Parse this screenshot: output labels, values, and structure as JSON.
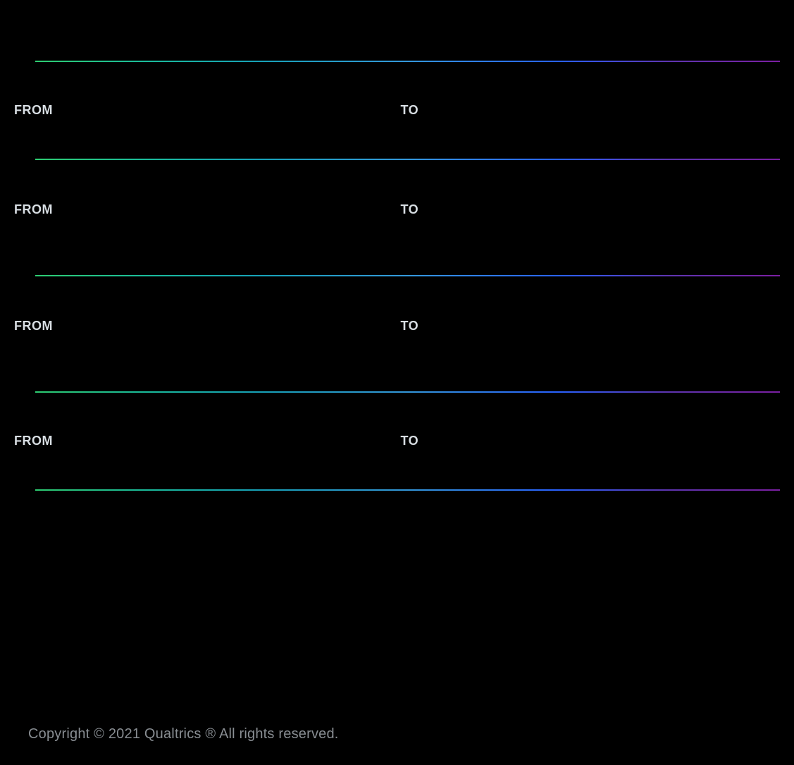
{
  "labels": {
    "from": "FROM",
    "to": "TO"
  },
  "sections": [
    {
      "from": "FROM",
      "to": "TO"
    },
    {
      "from": "FROM",
      "to": "TO"
    },
    {
      "from": "FROM",
      "to": "TO"
    },
    {
      "from": "FROM",
      "to": "TO"
    }
  ],
  "footer": "Copyright © 2021 Qualtrics ® All rights reserved."
}
